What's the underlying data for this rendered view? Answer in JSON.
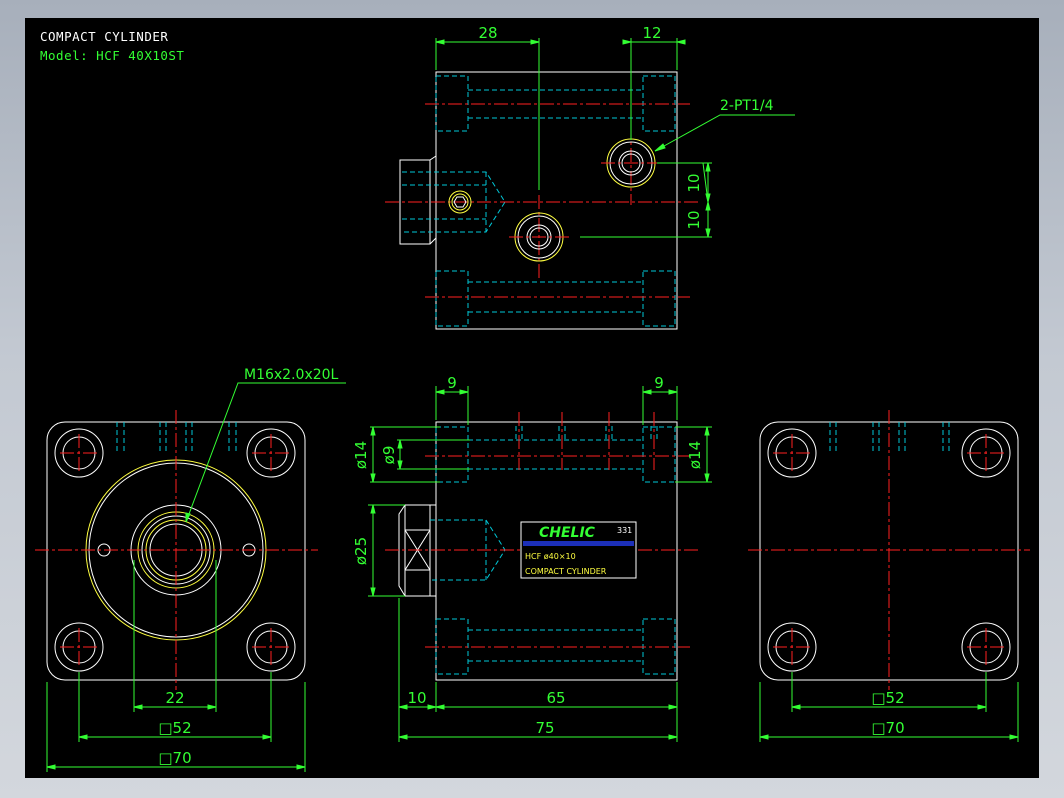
{
  "title": {
    "heading": "COMPACT CYLINDER",
    "model": "Model: HCF 40X10ST"
  },
  "colors": {
    "background": "#000000",
    "outline": "#ffffff",
    "hidden_line": "#00c8d8",
    "center_line": "#ff2020",
    "dimension": "#33ff33",
    "edge": "#ffff40",
    "nameplate_blue": "#1c2fb8"
  },
  "top_view": {
    "dim_left": "28",
    "dim_right": "12",
    "port_callout": "2-PT1/4",
    "dim_port_upper": "10",
    "dim_port_lower": "10"
  },
  "left_view": {
    "thread_callout": "M16x2.0x20L",
    "dim_rod": "22",
    "dim_bolt_square": "□52",
    "dim_body_square": "□70"
  },
  "front_view": {
    "dim_left_counterbore": "9",
    "dim_right_counterbore": "9",
    "dim_counterbore_dia_left": "ø14",
    "dim_hole_dia": "ø9",
    "dim_counterbore_dia_right": "ø14",
    "dim_rod_dia": "ø25",
    "dim_rod_ext": "10",
    "dim_body_len": "65",
    "dim_total_len": "75",
    "nameplate": {
      "brand": "CHELIC",
      "code": "331",
      "model_line": "HCF ø40×10",
      "name_line": "COMPACT CYLINDER"
    }
  },
  "right_view": {
    "dim_bolt_square": "□52",
    "dim_body_square": "□70"
  }
}
